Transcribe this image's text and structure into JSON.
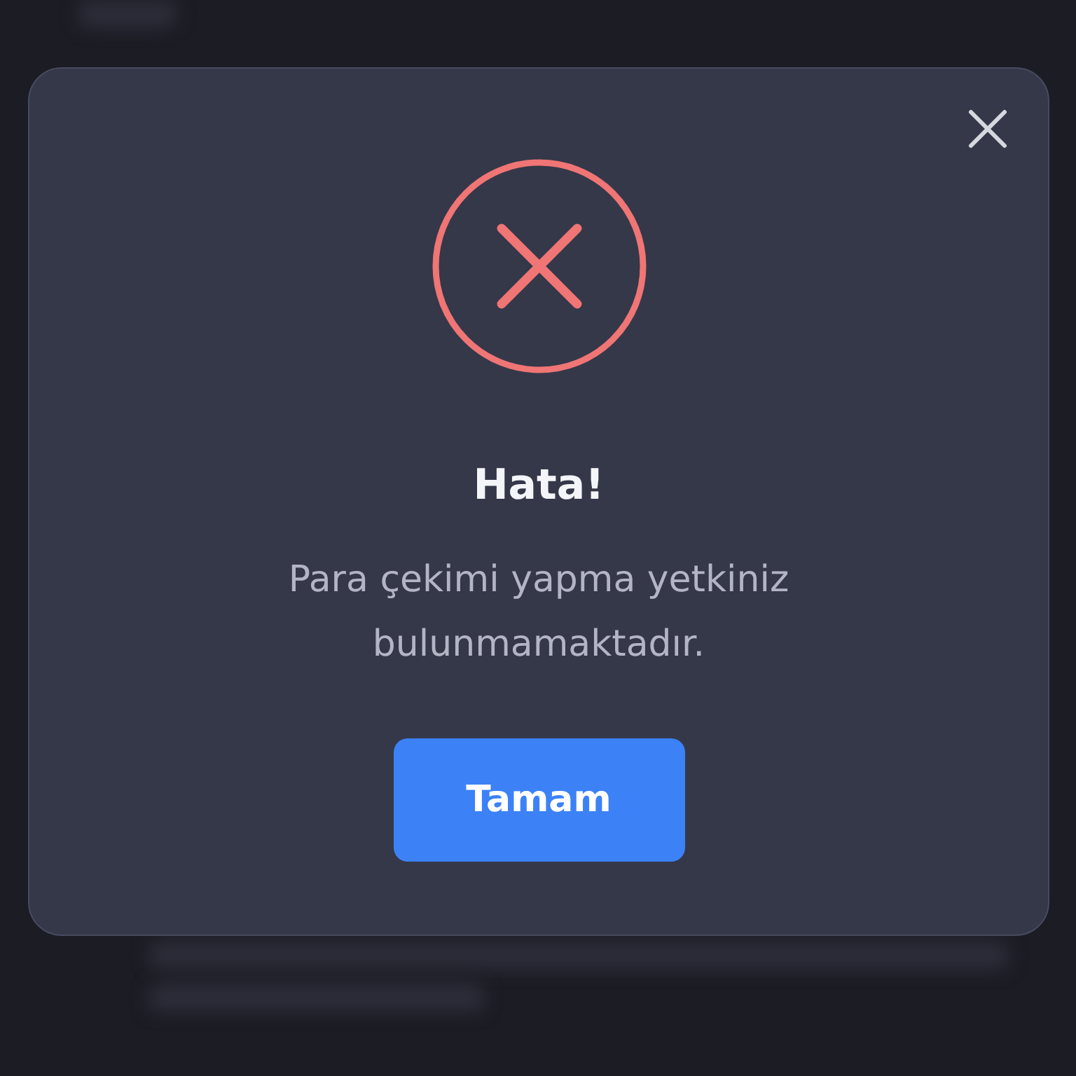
{
  "dialog": {
    "kind": "error",
    "title": "Hata!",
    "message": "Para çekimi yapma yetkiniz bulunmamaktadır.",
    "buttons": [
      {
        "label": "Tamam"
      }
    ]
  }
}
